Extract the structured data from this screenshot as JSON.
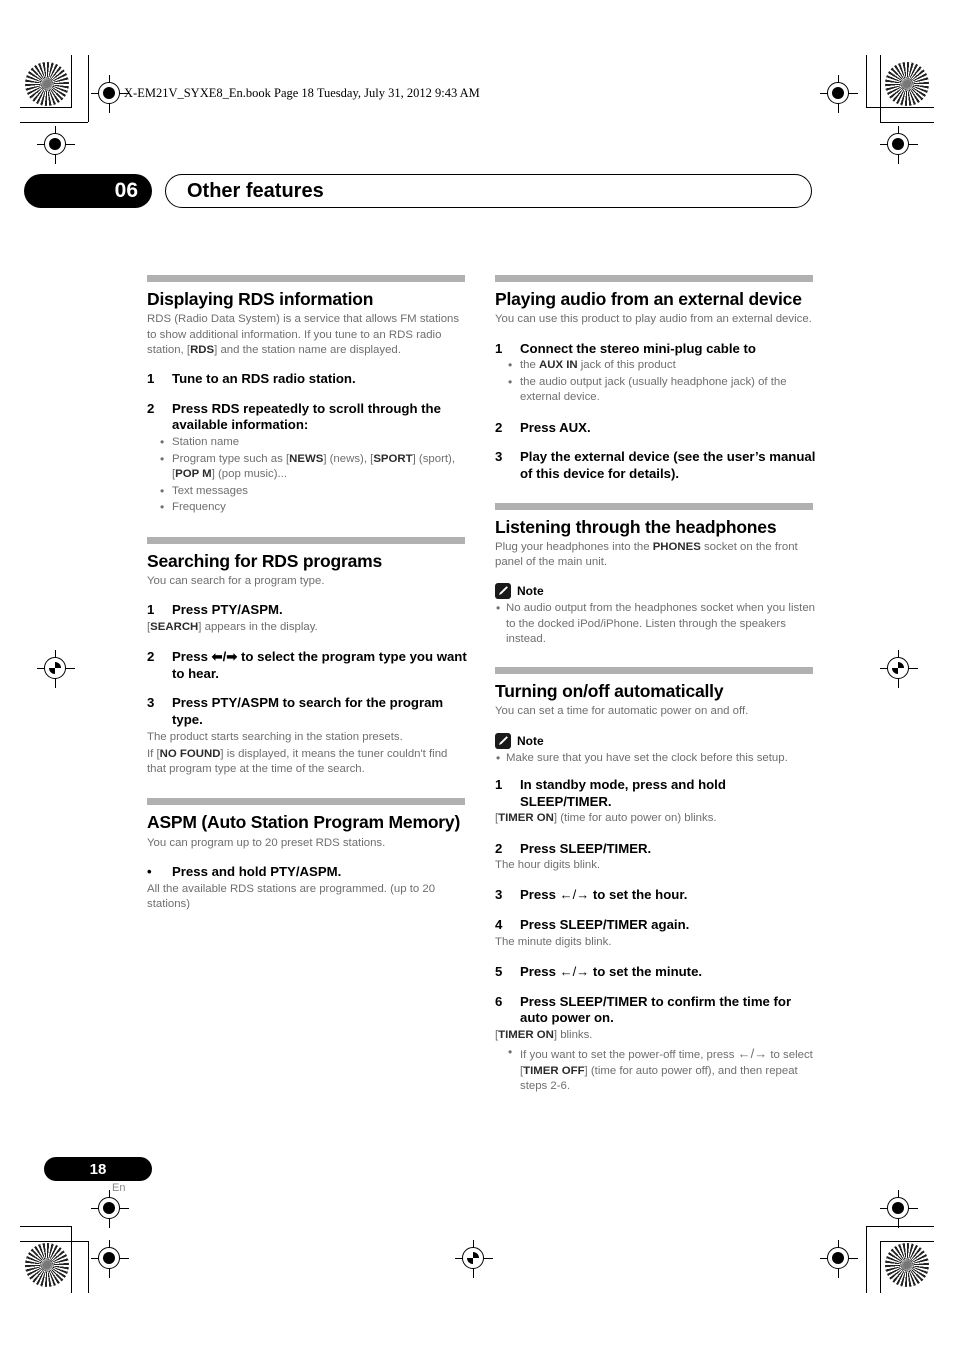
{
  "file_header": "X-EM21V_SYXE8_En.book  Page 18  Tuesday, July 31, 2012  9:43 AM",
  "chapter": {
    "number": "06",
    "title": "Other features"
  },
  "footer": {
    "page_number": "18",
    "language": "En"
  },
  "note_label": "Note",
  "sections": {
    "rds_info": {
      "heading": "Displaying RDS information",
      "intro_a": "RDS (Radio Data System) is a service that allows FM stations to show additional information. If you tune to an RDS radio station, [",
      "intro_b": "RDS",
      "intro_c": "] and the station name are displayed.",
      "step1_num": "1",
      "step1_text": "Tune to an RDS radio station.",
      "step2_num": "2",
      "step2_text": "Press RDS repeatedly to scroll through the available information:",
      "bullet1": "Station name",
      "bullet2_a": "Program type such as [",
      "bullet2_b": "NEWS",
      "bullet2_c": "] (news), [",
      "bullet2_d": "SPORT",
      "bullet2_e": "] (sport), [",
      "bullet2_f": "POP M",
      "bullet2_g": "] (pop music)...",
      "bullet3": "Text messages",
      "bullet4": "Frequency"
    },
    "rds_search": {
      "heading": "Searching for RDS programs",
      "intro": "You can search for a program type.",
      "step1_num": "1",
      "step1_text": "Press PTY/ASPM.",
      "step1_note_a": "[",
      "step1_note_b": "SEARCH",
      "step1_note_c": "] appears in the display.",
      "step2_num": "2",
      "step2_text_a": "Press ",
      "step2_arrows": "⬅/➡",
      "step2_text_b": " to select the program type you want to hear.",
      "step3_num": "3",
      "step3_text": "Press PTY/ASPM to search for the program type.",
      "step3_note1": "The product starts searching in the station presets.",
      "step3_note2_a": "If [",
      "step3_note2_b": "NO FOUND",
      "step3_note2_c": "] is displayed, it means the tuner couldn't find that program type at the time of the search."
    },
    "aspm": {
      "heading": "ASPM (Auto Station Program Memory)",
      "intro": "You can program up to 20 preset RDS stations.",
      "bullet_marker": "•",
      "step_text": "Press and hold PTY/ASPM.",
      "note": "All the available RDS stations are programmed. (up to 20 stations)"
    },
    "external_audio": {
      "heading": "Playing audio from an external device",
      "intro": "You can use this product to play audio from an external device.",
      "step1_num": "1",
      "step1_text": "Connect the stereo mini-plug cable to",
      "bullet1_a": "the ",
      "bullet1_b": "AUX IN",
      "bullet1_c": " jack of this product",
      "bullet2": "the audio output jack (usually headphone jack) of the external device.",
      "step2_num": "2",
      "step2_text": "Press AUX.",
      "step3_num": "3",
      "step3_text": "Play the external device (see the user’s manual of this device for details)."
    },
    "headphones": {
      "heading": "Listening through the headphones",
      "intro_a": "Plug your headphones into the ",
      "intro_b": "PHONES",
      "intro_c": " socket on the front panel of the main unit.",
      "note_bullet": "No audio output from the headphones socket when you listen to the docked iPod/iPhone. Listen through the speakers instead."
    },
    "auto_power": {
      "heading": "Turning on/off automatically",
      "intro": "You can set a time for automatic power on and off.",
      "note_bullet": "Make sure that you have set the clock before this setup.",
      "step1_num": "1",
      "step1_text": "In standby mode, press and hold SLEEP/TIMER.",
      "step1_note_a": "[",
      "step1_note_b": "TIMER ON",
      "step1_note_c": "] (time for auto power on) blinks.",
      "step2_num": "2",
      "step2_text": "Press SLEEP/TIMER.",
      "step2_note": "The hour digits blink.",
      "step3_num": "3",
      "step3_text_a": "Press ",
      "step3_arrows": "←/→",
      "step3_text_b": " to set the hour.",
      "step4_num": "4",
      "step4_text": "Press SLEEP/TIMER again.",
      "step4_note": "The minute digits blink.",
      "step5_num": "5",
      "step5_text_a": "Press ",
      "step5_arrows": "←/→",
      "step5_text_b": " to set the minute.",
      "step6_num": "6",
      "step6_text": "Press SLEEP/TIMER to confirm the time for auto power on.",
      "step6_note_a": "[",
      "step6_note_b": "TIMER ON",
      "step6_note_c": "] blinks.",
      "final_bullet_a": "If you want to set the power-off time, press ",
      "final_bullet_arrows": "←/→",
      "final_bullet_b": " to select [",
      "final_bullet_c": "TIMER OFF",
      "final_bullet_d": "] (time for auto power off), and then repeat steps 2-6."
    }
  }
}
